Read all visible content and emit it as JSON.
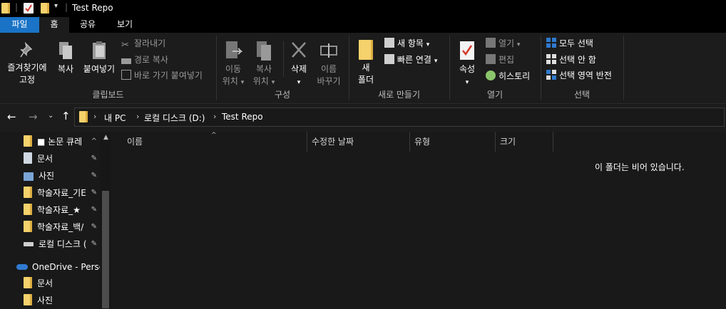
{
  "window": {
    "title": "Test Repo"
  },
  "tabs": [
    "파일",
    "홈",
    "공유",
    "보기"
  ],
  "ribbon": {
    "clipboard": {
      "pin_label_1": "즐겨찾기에",
      "pin_label_2": "고정",
      "copy": "복사",
      "paste": "붙여넣기",
      "cut": "잘라내기",
      "copy_path": "경로 복사",
      "paste_shortcut": "바로 가기 붙여넣기",
      "group": "클립보드"
    },
    "organize": {
      "move_1": "이동",
      "move_2": "위치",
      "copy_1": "복사",
      "copy_2": "위치",
      "delete": "삭제",
      "rename_1": "이름",
      "rename_2": "바꾸기",
      "group": "구성"
    },
    "new": {
      "folder_1": "새",
      "folder_2": "폴더",
      "new_item": "새 항목",
      "easy_access": "빠른 연결",
      "group": "새로 만들기"
    },
    "open": {
      "properties": "속성",
      "open": "열기",
      "edit": "편집",
      "history": "히스토리",
      "group": "열기"
    },
    "select": {
      "select_all": "모두 선택",
      "select_none": "선택 안 함",
      "invert": "선택 영역 반전",
      "group": "선택"
    }
  },
  "address": {
    "crumbs": [
      "내 PC",
      "로컬 디스크 (D:)",
      "Test Repo"
    ]
  },
  "nav": {
    "items": [
      {
        "label": "■ 논문 큐레",
        "icon": "folder-icon",
        "pinned": true
      },
      {
        "label": "문서",
        "icon": "documents-icon",
        "pinned": true
      },
      {
        "label": "사진",
        "icon": "pictures-icon",
        "pinned": true
      },
      {
        "label": "학술자료_기E",
        "icon": "folder-icon",
        "pinned": true
      },
      {
        "label": "학술자료_★",
        "icon": "folder-icon",
        "pinned": true
      },
      {
        "label": "학술자료_백/",
        "icon": "folder-icon",
        "pinned": true
      },
      {
        "label": "로컬 디스크 (",
        "icon": "drive-icon",
        "pinned": true
      }
    ],
    "onedrive": "OneDrive - Persor",
    "onedrive_items": [
      "문서",
      "사진"
    ]
  },
  "columns": [
    "이름",
    "수정한 날짜",
    "유형",
    "크기"
  ],
  "empty_message": "이 폴더는 비어 있습니다.",
  "colors": {
    "accent": "#1a73c6",
    "folder": "#f5d26b",
    "background": "#191919"
  }
}
